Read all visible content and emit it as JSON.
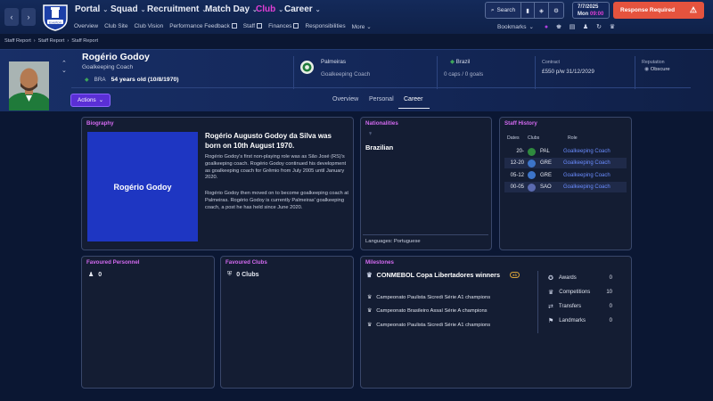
{
  "topbar": {
    "nav": [
      "Portal",
      "Squad",
      "Recruitment",
      "Match Day",
      "Club",
      "Career"
    ],
    "active_nav": "Club",
    "subnav": [
      "Overview",
      "Club Site",
      "Club Vision",
      "Performance Feedback",
      "Staff",
      "Finances",
      "Responsibilities",
      "More"
    ],
    "search_label": "Search",
    "date": "7/7/2025",
    "day": "Mon",
    "time": "09:00",
    "response_label": "Response Required",
    "bookmarks_label": "Bookmarks",
    "crest_text": "Everton"
  },
  "breadcrumb": [
    "Staff Report",
    "Staff Report",
    "Staff Report"
  ],
  "profile": {
    "name": "Rogério Godoy",
    "role": "Goalkeeping Coach",
    "nationality_code": "BRA",
    "age": "54 years old (10/8/1970)",
    "club": "Palmeiras",
    "club_role": "Goalkeeping Coach",
    "country": "Brazil",
    "caps": "0 caps / 0 goals",
    "contract_label": "Contract",
    "contract_value": "£550 p/w  31/12/2029",
    "reputation_label": "Reputation",
    "reputation_value": "Obscure",
    "actions_label": "Actions",
    "tabs": [
      "Overview",
      "Personal",
      "Career"
    ],
    "active_tab": "Career"
  },
  "biography": {
    "title": "Biography",
    "image_text": "Rogério Godoy",
    "headline": "Rogério Augusto Godoy da Silva was born on 10th August 1970.",
    "para1": "Rogério Godoy's first non-playing role was as São José (RS)'s goalkeeping coach. Rogério Godoy continued his development as goalkeeping coach for Grêmio from July 2005 until January 2020.",
    "para2": "Rogério Godoy then moved on to become goalkeeping coach at Palmeiras. Rogério Godoy is currently Palmeiras' goalkeeping coach, a post he has held since June 2020."
  },
  "nationalities": {
    "title": "Nationalities",
    "value": "Brazilian",
    "languages": "Languages: Portuguese"
  },
  "staff_history": {
    "title": "Staff History",
    "headers": [
      "Dates",
      "Clubs",
      "Role"
    ],
    "rows": [
      {
        "dates": "20-",
        "club": "PAL",
        "role": "Goalkeeping Coach",
        "color": "#2f8a3e"
      },
      {
        "dates": "12-20",
        "club": "GRE",
        "role": "Goalkeeping Coach",
        "color": "#3c74c9"
      },
      {
        "dates": "05-12",
        "club": "GRE",
        "role": "Goalkeeping Coach",
        "color": "#3c74c9"
      },
      {
        "dates": "00-05",
        "club": "SAO",
        "role": "Goalkeeping Coach",
        "color": "#5a6ab0"
      }
    ]
  },
  "favoured_personnel": {
    "title": "Favoured Personnel",
    "count": "0"
  },
  "favoured_clubs": {
    "title": "Favoured Clubs",
    "value": "0 Clubs"
  },
  "milestones": {
    "title": "Milestones",
    "main": "CONMEBOL Copa Libertadores winners",
    "main_badge": "x1",
    "items": [
      "Campeonato Paulista Sicredi Série A1 champions",
      "Campeonato Brasileiro Assaí Série A champions",
      "Campeonato Paulista Sicredi Série A1 champions"
    ],
    "stats": [
      {
        "label": "Awards",
        "value": "0"
      },
      {
        "label": "Competitions",
        "value": "10"
      },
      {
        "label": "Transfers",
        "value": "0"
      },
      {
        "label": "Landmarks",
        "value": "0"
      }
    ]
  }
}
